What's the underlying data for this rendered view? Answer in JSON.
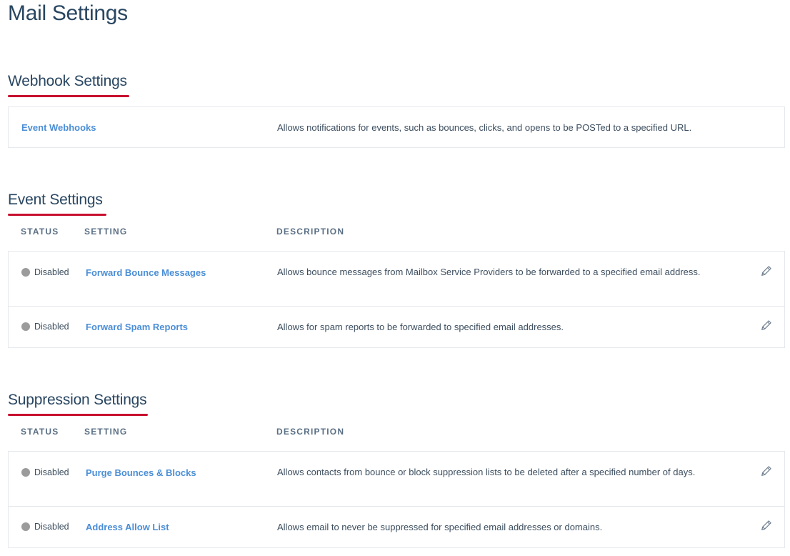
{
  "page": {
    "title": "Mail Settings"
  },
  "colors": {
    "accent_underline": "#c8102e",
    "link": "#4b8ed6",
    "heading": "#294661",
    "status_disabled_dot": "#9b9b9b"
  },
  "webhook_section": {
    "title": "Webhook Settings",
    "rows": [
      {
        "setting": "Event Webhooks",
        "description": "Allows notifications for events, such as bounces, clicks, and opens to be POSTed to a specified URL."
      }
    ]
  },
  "event_section": {
    "title": "Event Settings",
    "columns": [
      "STATUS",
      "SETTING",
      "DESCRIPTION"
    ],
    "rows": [
      {
        "status": "Disabled",
        "setting": "Forward Bounce Messages",
        "description": "Allows bounce messages from Mailbox Service Providers to be forwarded to a specified email address.",
        "icon": "pencil-icon"
      },
      {
        "status": "Disabled",
        "setting": "Forward Spam Reports",
        "description": "Allows for spam reports to be forwarded to specified email addresses.",
        "icon": "pencil-icon"
      }
    ]
  },
  "suppression_section": {
    "title": "Suppression Settings",
    "columns": [
      "STATUS",
      "SETTING",
      "DESCRIPTION"
    ],
    "rows": [
      {
        "status": "Disabled",
        "setting": "Purge Bounces & Blocks",
        "description": "Allows contacts from bounce or block suppression lists to be deleted after a specified number of days.",
        "icon": "pencil-icon"
      },
      {
        "status": "Disabled",
        "setting": "Address Allow List",
        "description": "Allows email to never be suppressed for specified email addresses or domains.",
        "icon": "pencil-icon"
      }
    ]
  }
}
